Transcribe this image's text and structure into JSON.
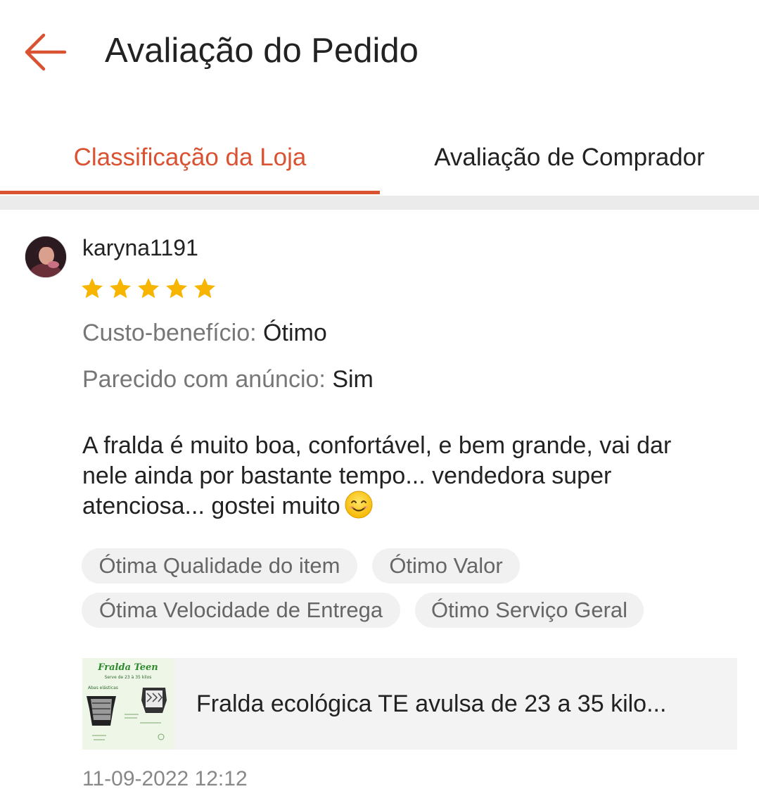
{
  "header": {
    "title": "Avaliação do Pedido",
    "back_icon": "arrow-left-icon"
  },
  "tabs": [
    {
      "label": "Classificação da Loja",
      "active": true
    },
    {
      "label": "Avaliação de Comprador",
      "active": false
    }
  ],
  "review": {
    "username": "karyna1191",
    "rating": 5,
    "max_rating": 5,
    "attributes": [
      {
        "label": "Custo-benefício:",
        "value": "Ótimo"
      },
      {
        "label": "Parecido com anúncio:",
        "value": "Sim"
      }
    ],
    "text": "A fralda é muito boa, confortável, e bem grande, vai dar nele ainda por bastante tempo... vendedora super atenciosa... gostei muito",
    "text_emoji": "smiling-face-icon",
    "tags": [
      "Ótima Qualidade do item",
      "Ótimo Valor",
      "Ótima Velocidade de Entrega",
      "Ótimo Serviço Geral"
    ],
    "product": {
      "name": "Fralda ecológica TE  avulsa de 23 a 35 kilo...",
      "thumb_title": "Fralda Teen",
      "thumb_subtitle": "Serve de 23 à 35 kilos",
      "thumb_label": "Abas elásticas"
    },
    "date": "11-09-2022 12:12"
  },
  "colors": {
    "accent": "#d95333",
    "star": "#f7b500",
    "tag_bg": "#f1f1f1",
    "divider": "#ebebeb"
  }
}
